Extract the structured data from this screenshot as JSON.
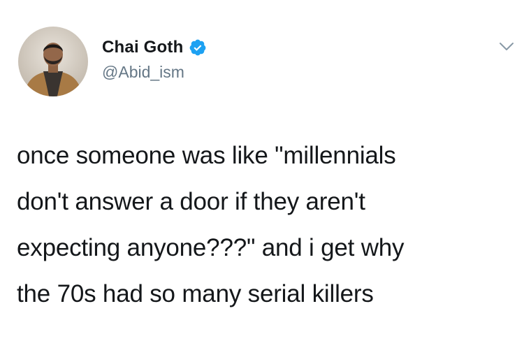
{
  "author": {
    "display_name": "Chai Goth",
    "handle": "@Abid_ism",
    "verified": true,
    "avatar_icon": "profile-photo"
  },
  "tweet": {
    "lines": [
      "once someone was like \"millennials",
      "don't answer a door if they aren't",
      "expecting anyone???\" and i get why",
      "the 70s had so many serial killers"
    ]
  },
  "icons": {
    "verified": "verified-badge-icon",
    "menu": "chevron-down-icon"
  },
  "colors": {
    "verified_blue": "#1da1f2",
    "handle_gray": "#657786",
    "text": "#14171a",
    "background": "#ffffff"
  }
}
